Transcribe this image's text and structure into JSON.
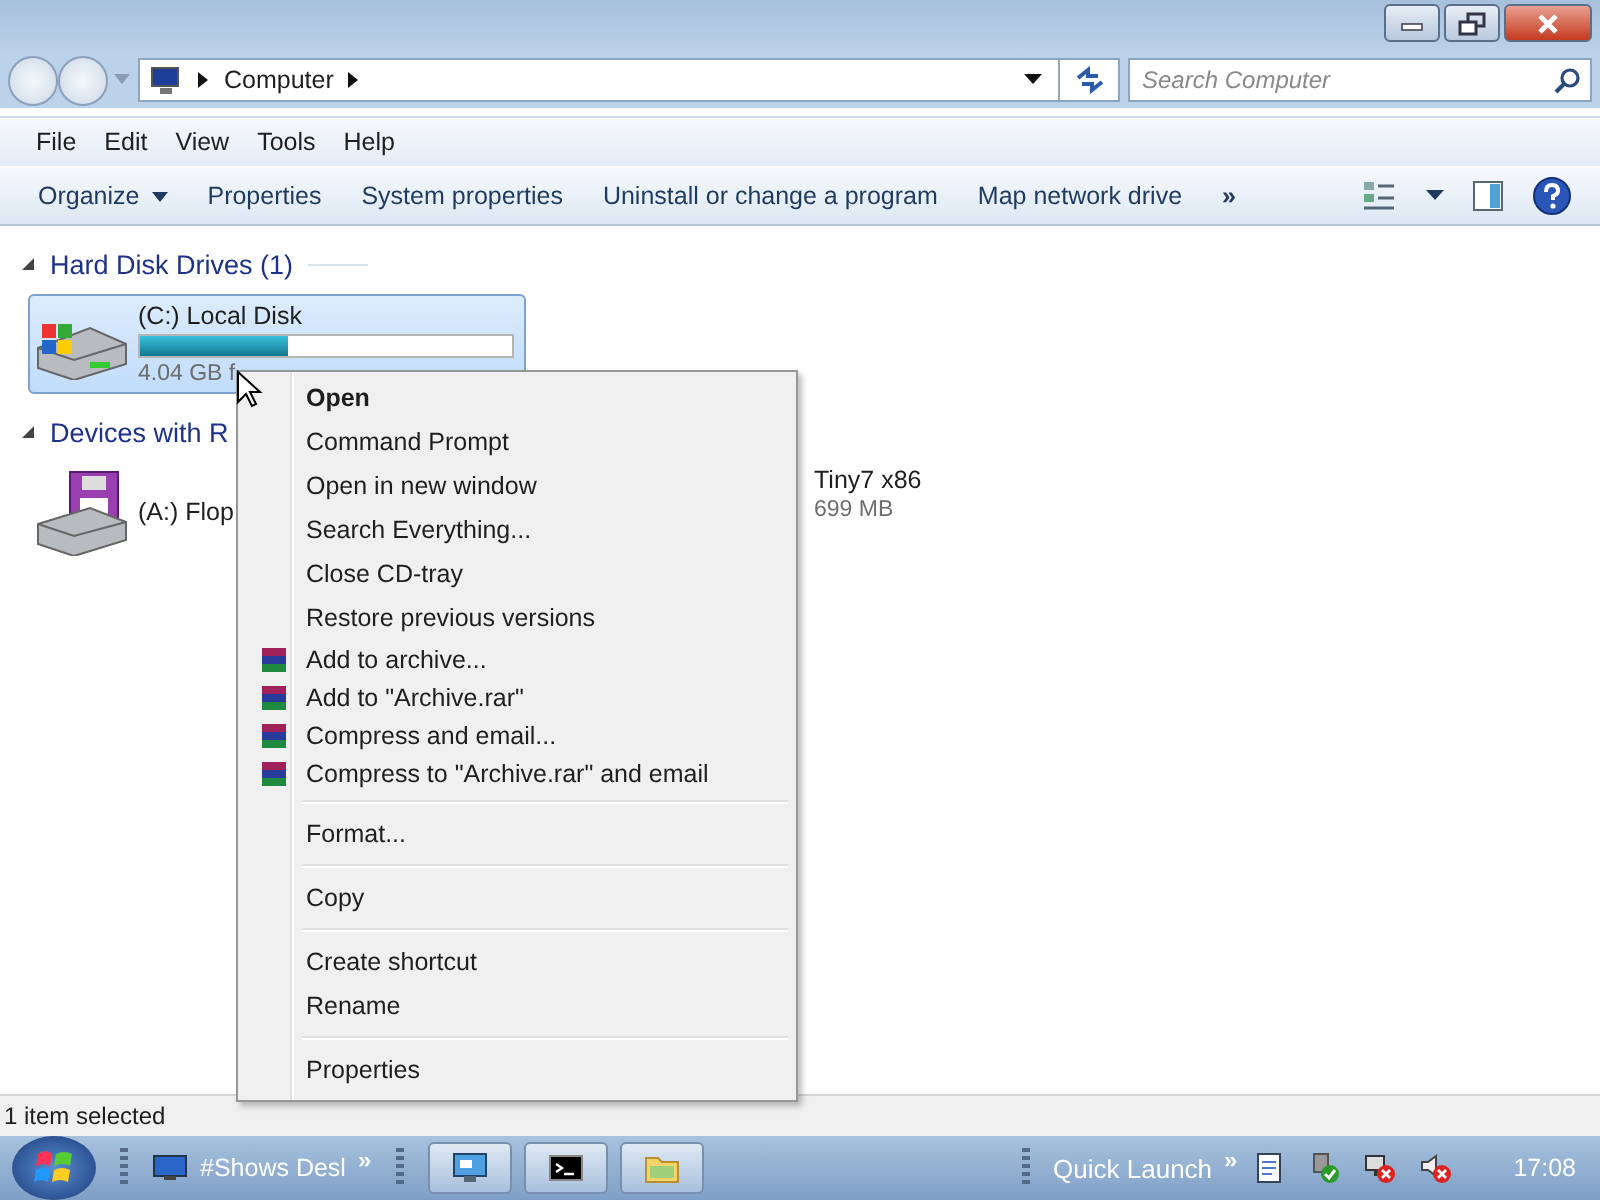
{
  "address": {
    "location": "Computer",
    "search": {
      "placeholder": "Search Computer"
    }
  },
  "menubar": [
    {
      "label": "File"
    },
    {
      "label": "Edit"
    },
    {
      "label": "View"
    },
    {
      "label": "Tools"
    },
    {
      "label": "Help"
    }
  ],
  "toolbar": [
    {
      "label": "Organize",
      "kind": "dropdown"
    },
    {
      "label": "Properties",
      "kind": "button"
    },
    {
      "label": "System properties",
      "kind": "button"
    },
    {
      "label": "Uninstall or change a program",
      "kind": "button"
    },
    {
      "label": "Map network drive",
      "kind": "button"
    },
    {
      "label": "»",
      "kind": "overflow"
    }
  ],
  "groups": [
    {
      "title": "Hard Disk Drives (1)",
      "expanded": true,
      "items": [
        {
          "name": "(C:) Local Disk",
          "kind": "hdd",
          "selected": true,
          "level": 0.4,
          "detail": "4.04 GB f"
        }
      ]
    },
    {
      "title": "Devices with R",
      "expanded": true,
      "items": [
        {
          "name": "(A:) Flop",
          "kind": "floppy",
          "selected": false
        },
        {
          "name": "Tiny7 x86",
          "kind": "dvd",
          "detail": "699 MB"
        }
      ]
    }
  ],
  "context_menu": [
    [
      {
        "label": "Open",
        "default": true
      },
      {
        "label": "Command Prompt",
        "default": false
      },
      {
        "label": "Open in new window",
        "default": false
      },
      {
        "label": "Search Everything...",
        "default": false
      },
      {
        "label": "Close CD-tray",
        "default": false
      },
      {
        "label": "Restore previous versions",
        "default": false
      },
      {
        "label": "Add to archive...",
        "default": false,
        "kind": "archive"
      },
      {
        "label": "Add to \"Archive.rar\"",
        "default": false,
        "kind": "archive"
      },
      {
        "label": "Compress and email...",
        "default": false,
        "kind": "archive"
      },
      {
        "label": "Compress to \"Archive.rar\" and email",
        "default": false,
        "kind": "archive"
      }
    ],
    [
      {
        "label": "Format...",
        "default": false
      }
    ],
    [
      {
        "label": "Copy",
        "default": false
      }
    ],
    [
      {
        "label": "Create shortcut",
        "default": false
      },
      {
        "label": "Rename",
        "default": false
      }
    ],
    [
      {
        "label": "Properties",
        "default": false
      }
    ]
  ],
  "status_bar": "1 item selected",
  "taskbar": {
    "toolbar": {
      "label": "#Shows Desl",
      "chevron": "»"
    },
    "buttons": [
      {
        "kind": "remote"
      },
      {
        "kind": "console"
      },
      {
        "kind": "folder"
      }
    ],
    "quick_launch": {
      "label": "Quick Launch",
      "chevron": "»"
    },
    "tray": [
      {
        "kind": "notes"
      },
      {
        "kind": "usb"
      },
      {
        "kind": "network"
      },
      {
        "kind": "volume"
      }
    ],
    "clock": "17:08"
  }
}
